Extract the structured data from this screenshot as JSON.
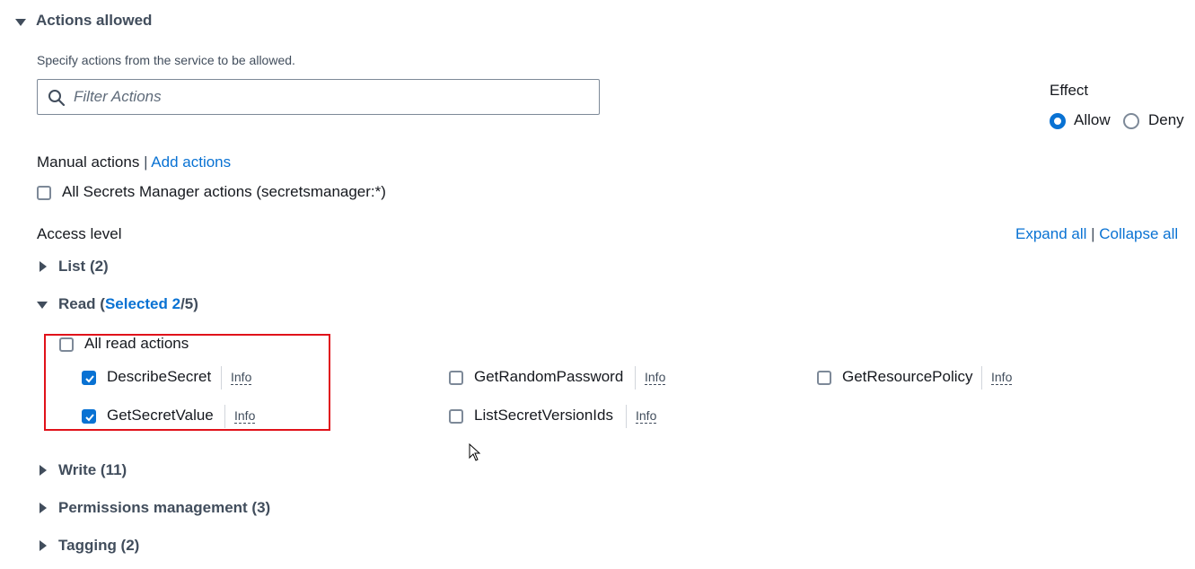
{
  "section": {
    "title": "Actions allowed",
    "description": "Specify actions from the service to be allowed."
  },
  "search": {
    "placeholder": "Filter Actions",
    "value": ""
  },
  "effect": {
    "label": "Effect",
    "options": [
      {
        "label": "Allow",
        "selected": true
      },
      {
        "label": "Deny",
        "selected": false
      }
    ]
  },
  "manual": {
    "label": "Manual actions",
    "separator": "|",
    "add_link": "Add actions",
    "all_actions_label": "All Secrets Manager actions (secretsmanager:*)",
    "all_actions_checked": false
  },
  "access_level": {
    "label": "Access level",
    "expand_all": "Expand all",
    "separator": "|",
    "collapse_all": "Collapse all"
  },
  "groups": {
    "list": {
      "label": "List (2)",
      "expanded": false
    },
    "read": {
      "label_prefix": "Read (",
      "selected_text": "Selected 2",
      "label_suffix": "/5)",
      "expanded": true,
      "all_label": "All read actions",
      "all_checked": false,
      "actions": [
        {
          "label": "DescribeSecret",
          "checked": true,
          "info": "Info"
        },
        {
          "label": "GetSecretValue",
          "checked": true,
          "info": "Info"
        },
        {
          "label": "GetRandomPassword",
          "checked": false,
          "info": "Info"
        },
        {
          "label": "ListSecretVersionIds",
          "checked": false,
          "info": "Info"
        },
        {
          "label": "GetResourcePolicy",
          "checked": false,
          "info": "Info"
        }
      ]
    },
    "write": {
      "label": "Write (11)",
      "expanded": false
    },
    "permissions": {
      "label": "Permissions management (3)",
      "expanded": false
    },
    "tagging": {
      "label": "Tagging (2)",
      "expanded": false
    }
  },
  "colors": {
    "accent": "#0972d3",
    "highlight_border": "#e0121a",
    "heading_text": "#414d5c"
  }
}
